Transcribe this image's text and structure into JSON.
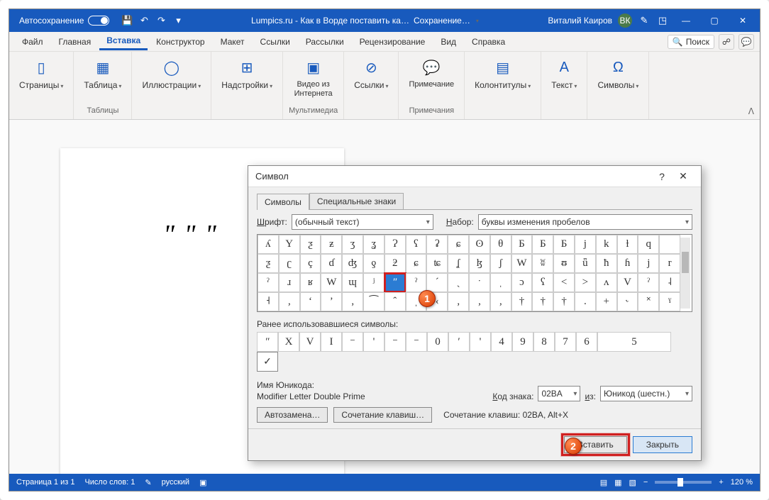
{
  "titlebar": {
    "autosave": "Автосохранение",
    "doc_title_1": "Lumpics.ru - Как в Ворде поставить ка…",
    "doc_title_2": "Сохранение…",
    "user_name": "Виталий Каиров",
    "user_initials": "ВК"
  },
  "tabs": {
    "file": "Файл",
    "home": "Главная",
    "insert": "Вставка",
    "designer": "Конструктор",
    "layout": "Макет",
    "references": "Ссылки",
    "mailings": "Рассылки",
    "review": "Рецензирование",
    "view": "Вид",
    "help": "Справка",
    "search": "Поиск"
  },
  "ribbon": {
    "pages": {
      "label": "Страницы"
    },
    "tables": {
      "btn": "Таблица",
      "group": "Таблицы"
    },
    "illustrations": {
      "btn": "Иллюстрации"
    },
    "addins": {
      "btn": "Надстройки"
    },
    "media": {
      "btn": "Видео из\nИнтернета",
      "group": "Мультимедиа"
    },
    "links": {
      "btn": "Ссылки"
    },
    "comments": {
      "btn": "Примечание",
      "group": "Примечания"
    },
    "headerfooter": {
      "btn": "Колонтитулы"
    },
    "text": {
      "btn": "Текст"
    },
    "symbols": {
      "btn": "Символы"
    }
  },
  "document_text": "ʺ ʺ ʺ",
  "dialog": {
    "title": "Символ",
    "tab_symbols": "Символы",
    "tab_special": "Специальные знаки",
    "font_label": "Шрифт:",
    "font_value": "(обычный текст)",
    "subset_label": "Набор:",
    "subset_value": "буквы изменения пробелов",
    "grid": [
      [
        "ʎ",
        "Y",
        "ƺ",
        "ƶ",
        "ʒ",
        "ʓ",
        "Ɂ",
        "ʕ",
        "ʡ",
        "ɕ",
        "ʘ",
        "θ",
        "Б",
        "Ƃ",
        "Б",
        "j",
        "k",
        "ƚ",
        "q"
      ],
      [
        "ƺ",
        "ʗ",
        "ç",
        "ɗ",
        "ʤ",
        "ƍ",
        "ƻ",
        "ɕ",
        "ʨ",
        "ʆ",
        "ɮ",
        "ʃ",
        "W",
        "ʬ",
        "ᵿ",
        "ǖ",
        "ħ",
        "ɦ",
        "j",
        "r"
      ],
      [
        "ˀ",
        "ɹ",
        "ʁ",
        "W",
        "ɰ",
        "ʲ",
        "ʺ",
        "ˀ",
        "ˊ",
        "ˏ",
        "ˑ",
        "ˌ",
        "ɔ",
        "ʕ",
        "<",
        ">",
        "ʌ",
        "V",
        "ˀ",
        "˨"
      ],
      [
        "˧",
        "‚",
        "‘",
        "’",
        "‚",
        "⁀",
        "ˆ",
        "ˌ",
        "‹",
        "‚",
        "‚",
        "‚",
        "†",
        "†",
        "†",
        ".",
        "+",
        "˞",
        "˟",
        "ˠ"
      ]
    ],
    "recent_label": "Ранее использовавшиеся символы:",
    "recent": [
      "ʺ",
      "X",
      "V",
      "I",
      "⁻",
      "'",
      "⁻",
      "⁻",
      "0",
      "′",
      "'",
      "4",
      "9",
      "8",
      "7",
      "6",
      "5"
    ],
    "unicode_name_label": "Имя Юникода:",
    "unicode_name": "Modifier Letter Double Prime",
    "charcode_label": "Код знака:",
    "charcode": "02BA",
    "from_label": "из:",
    "from_value": "Юникод (шестн.)",
    "autocorrect": "Автозамена…",
    "shortcut": "Сочетание клавиш…",
    "shortcut_text": "Сочетание клавиш: 02BA, Alt+X",
    "insert": "Вставить",
    "close": "Закрыть"
  },
  "callouts": {
    "one": "1",
    "two": "2"
  },
  "statusbar": {
    "page": "Страница 1 из 1",
    "words": "Число слов: 1",
    "lang": "русский",
    "zoom": "120 %"
  }
}
